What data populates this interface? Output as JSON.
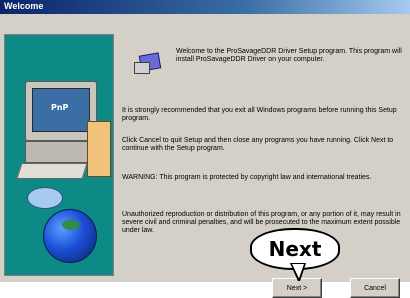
{
  "window": {
    "title": "Welcome"
  },
  "art": {
    "monitor_text": "PnP"
  },
  "content": {
    "welcome": "Welcome to the ProSavageDDR Driver Setup program. This program will install ProSavageDDR Driver on your computer.",
    "para_recommend": "It is strongly recommended that you exit all Windows programs before running this Setup program.",
    "para_cancel": "Click Cancel to quit Setup and then close any programs you have running. Click Next to continue with the Setup program.",
    "para_warning": "WARNING: This program is protected by copyright law and international treaties.",
    "para_unauthorized": "Unauthorized reproduction or distribution of this program, or any portion of it, may result in severe civil and criminal penalties, and will be prosecuted to the maximum extent possible under law."
  },
  "buttons": {
    "next": "Next >",
    "cancel": "Cancel"
  },
  "callout": {
    "label": "Next"
  }
}
